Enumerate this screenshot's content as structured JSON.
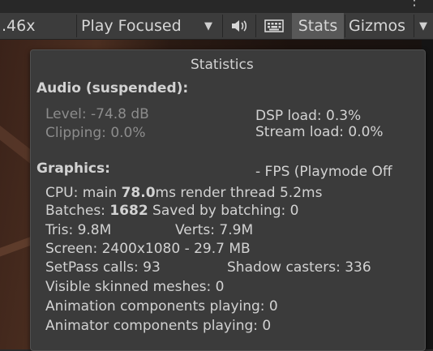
{
  "toolbar": {
    "zoom": ".46x",
    "play_mode": "Play Focused",
    "stats": "Stats",
    "gizmos": "Gizmos",
    "more_icon": "⋮",
    "dropdown_icon": "▼",
    "mute_icon": "speaker",
    "keyboard_icon": "keyboard"
  },
  "stats": {
    "title": "Statistics",
    "audio": {
      "heading": "Audio (suspended):",
      "level": "Level: -74.8 dB",
      "clipping": "Clipping: 0.0%",
      "dsp": "DSP load: 0.3%",
      "stream": "Stream load: 0.0%"
    },
    "graphics": {
      "heading": "Graphics:",
      "fps": "- FPS (Playmode Off",
      "cpu_pre": "CPU: main ",
      "cpu_main": "78.0",
      "cpu_post": "ms  render thread 5.2ms",
      "batches_pre": "Batches: ",
      "batches": "1682",
      "batches_post": "  Saved by batching: 0",
      "tris": "Tris: 9.8M",
      "verts": "Verts: 7.9M",
      "screen": "Screen: 2400x1080 - 29.7 MB",
      "setpass": "SetPass calls: 93",
      "shadow": "Shadow casters: 336",
      "skinned": "Visible skinned meshes: 0",
      "animation": "Animation components playing: 0",
      "animator": "Animator components playing: 0"
    }
  }
}
